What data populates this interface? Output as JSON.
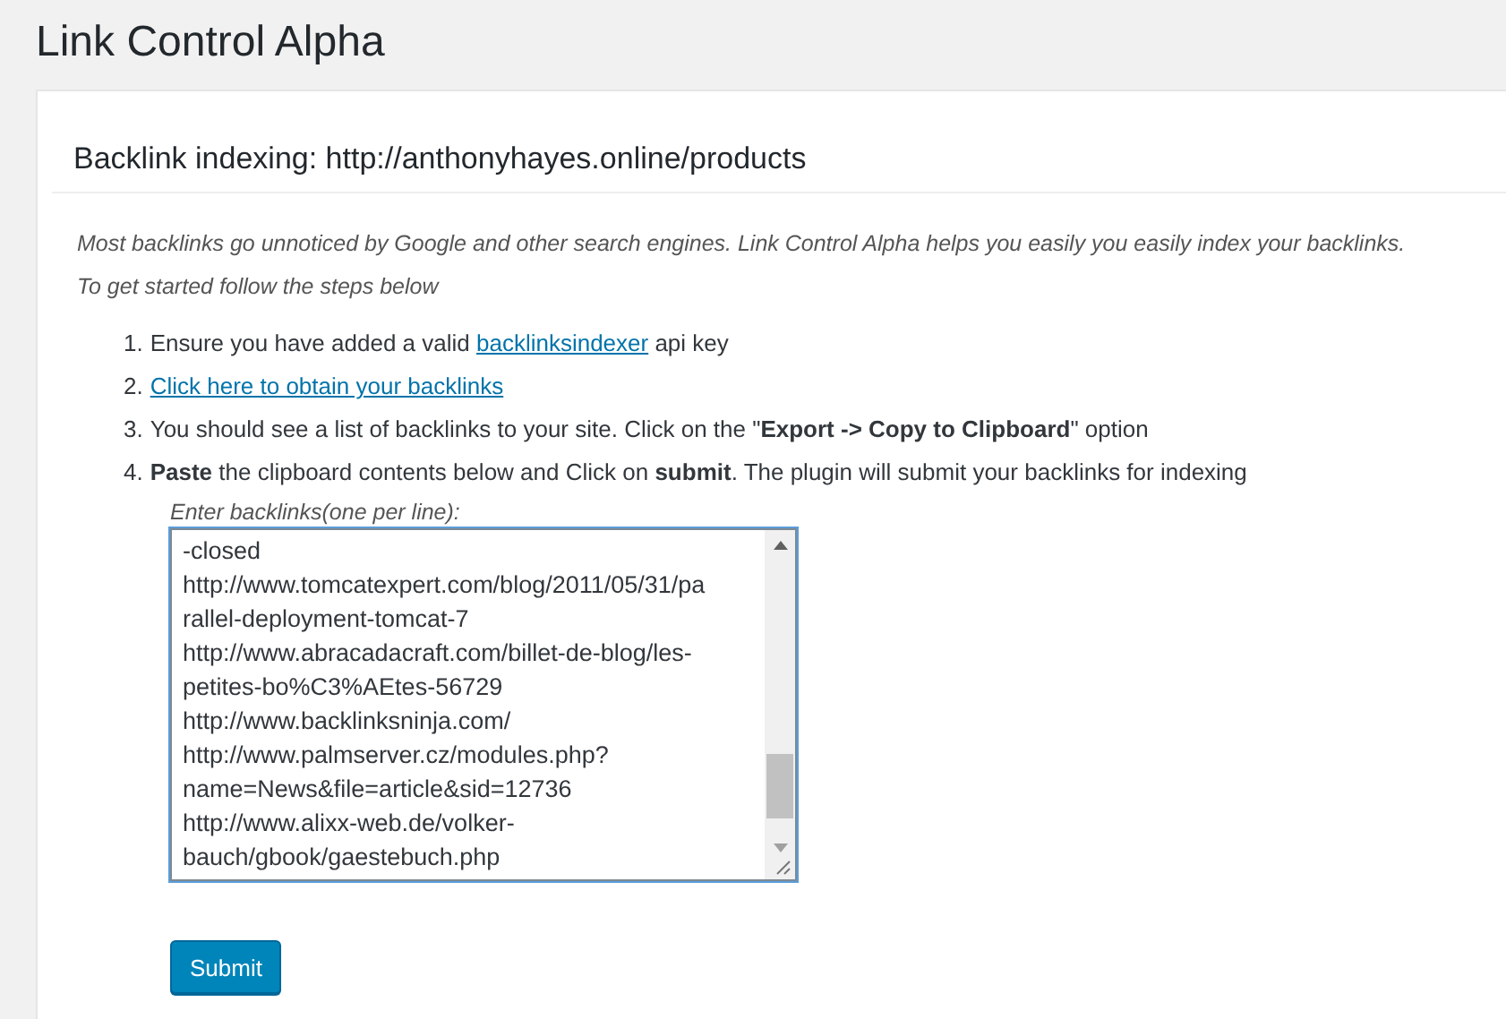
{
  "page_title": "Link Control Alpha",
  "section_title": "Backlink indexing: http://anthonyhayes.online/products",
  "intro": [
    "Most backlinks go unnoticed by Google and other search engines. Link Control Alpha helps you easily you easily index your backlinks.",
    "To get started follow the steps below"
  ],
  "steps": [
    {
      "number": "1.",
      "parts": [
        {
          "kind": "text",
          "text": "Ensure you have added a valid "
        },
        {
          "kind": "link",
          "text": "backlinksindexer"
        },
        {
          "kind": "text",
          "text": " api key"
        }
      ]
    },
    {
      "number": "2.",
      "parts": [
        {
          "kind": "link",
          "text": "Click here to obtain your backlinks"
        }
      ]
    },
    {
      "number": "3.",
      "parts": [
        {
          "kind": "text",
          "text": "You should see a list of backlinks to your site. Click on the \"**Export -> Copy to Clipboard**\" option"
        }
      ]
    },
    {
      "number": "4.",
      "parts": [
        {
          "kind": "text",
          "text": "**Paste** the clipboard contents below and Click on **submit**. The plugin will submit your backlinks for indexing"
        }
      ]
    }
  ],
  "backlinks_field": {
    "label": "Enter backlinks(one per line):",
    "lines": [
      "-closed",
      "http://www.tomcatexpert.com/blog/2011/05/31/pa",
      "rallel-deployment-tomcat-7",
      "http://www.abracadacraft.com/billet-de-blog/les-",
      "petites-bo%C3%AEtes-56729",
      "http://www.backlinksninja.com/",
      "http://www.palmserver.cz/modules.php?",
      "name=News&file=article&sid=12736",
      "http://www.alixx-web.de/volker-",
      "bauch/gbook/gaestebuch.php"
    ]
  },
  "submit_button": "Submit"
}
